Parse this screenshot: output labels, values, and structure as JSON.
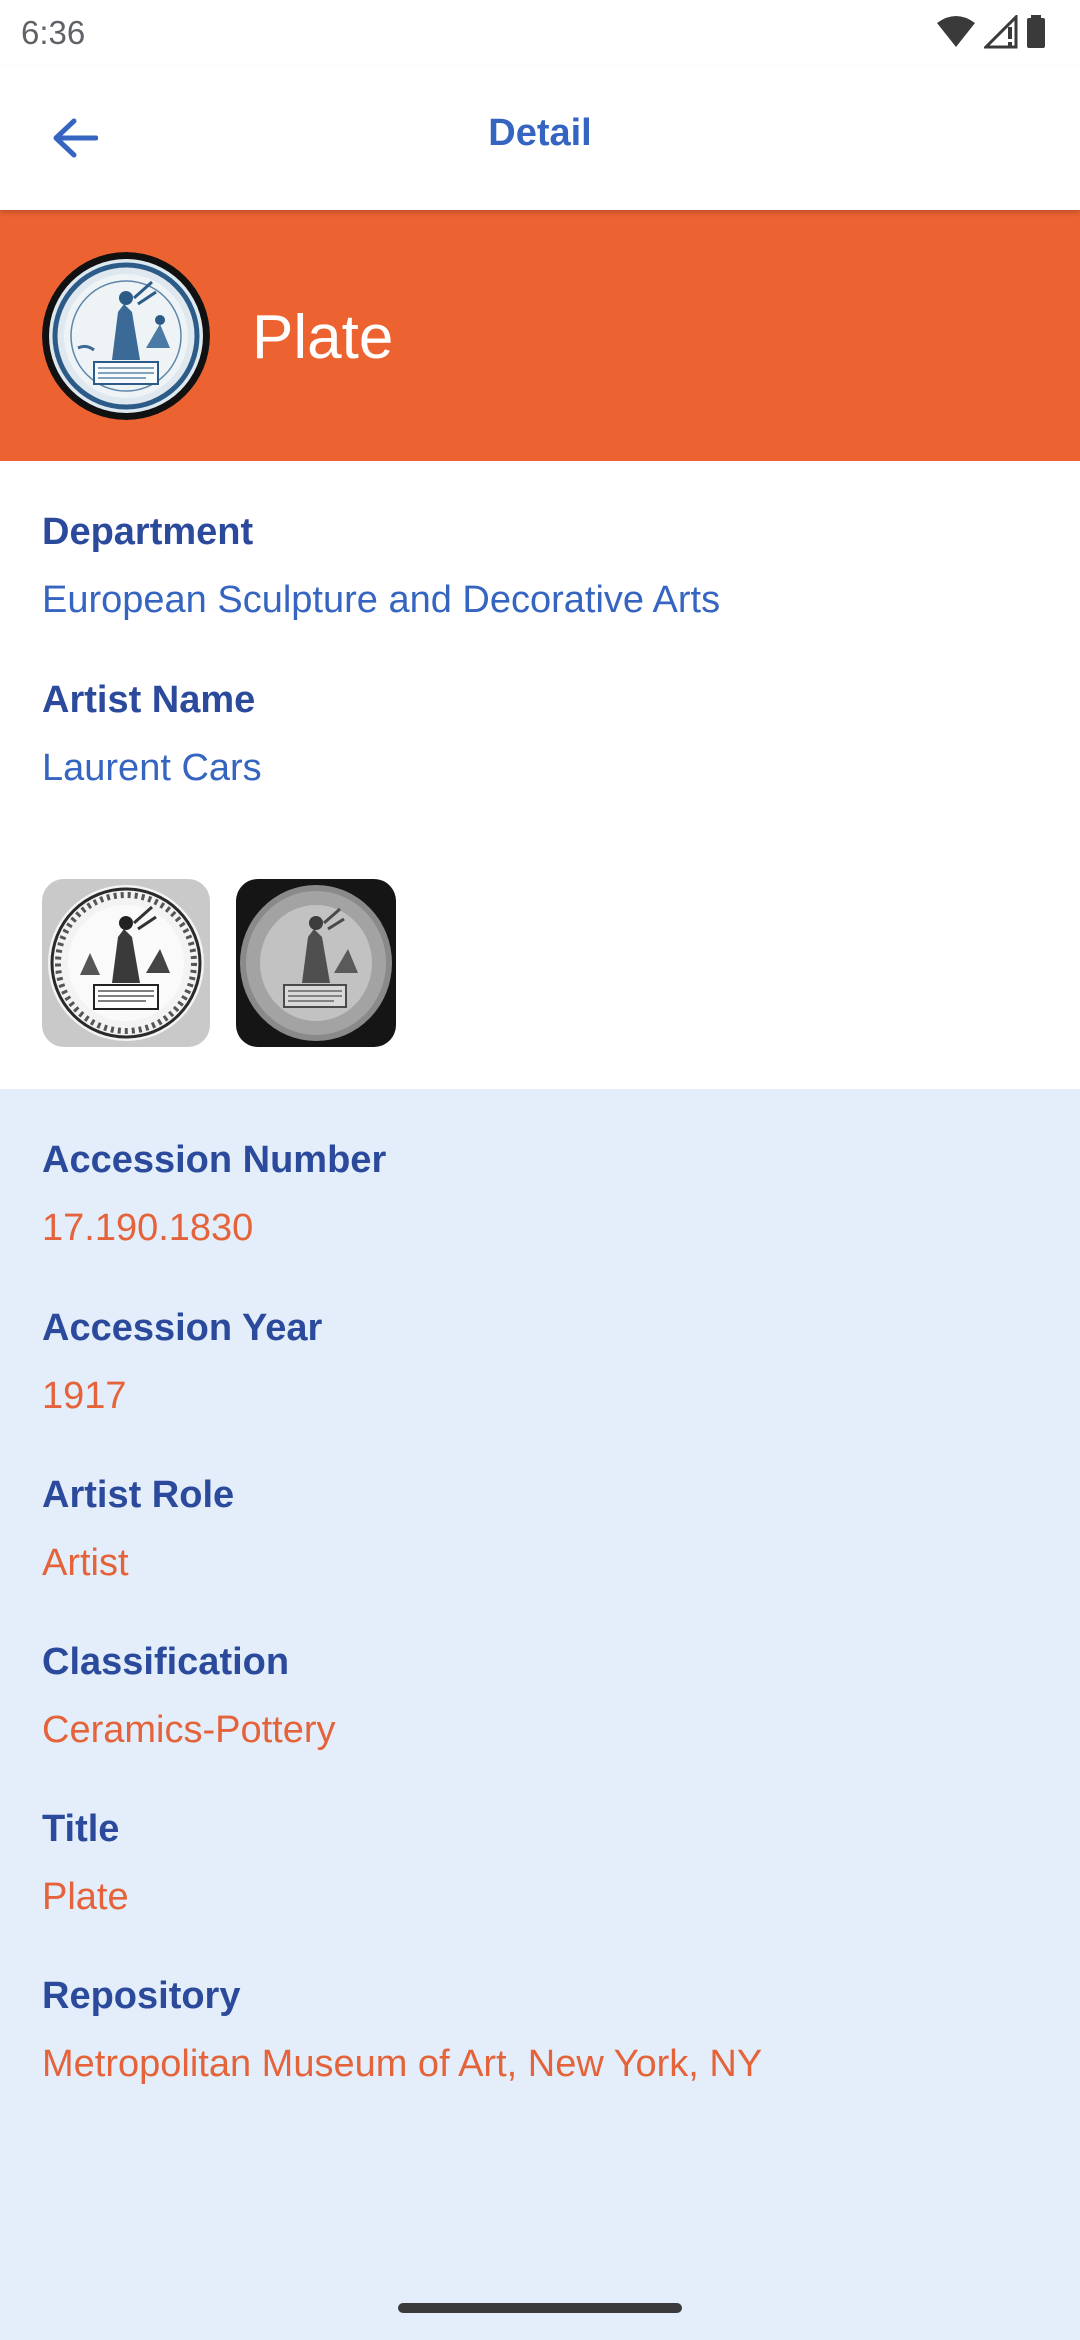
{
  "status_bar": {
    "time": "6:36",
    "icons": [
      "wifi-icon",
      "signal-icon",
      "battery-icon"
    ]
  },
  "app_bar": {
    "back_icon": "arrow-left-icon",
    "title": "Detail"
  },
  "header": {
    "title": "Plate",
    "thumbnail": "plate-thumbnail-image"
  },
  "primary": {
    "department_label": "Department",
    "department_value": "European Sculpture and Decorative Arts",
    "artist_name_label": "Artist Name",
    "artist_name_value": "Laurent Cars",
    "gallery": [
      "plate-photo-1",
      "plate-photo-2"
    ]
  },
  "details": {
    "accession_number_label": "Accession Number",
    "accession_number_value": "17.190.1830",
    "accession_year_label": "Accession Year",
    "accession_year_value": "1917",
    "artist_role_label": "Artist Role",
    "artist_role_value": "Artist",
    "classification_label": "Classification",
    "classification_value": "Ceramics-Pottery",
    "title_label": "Title",
    "title_value": "Plate",
    "repository_label": "Repository",
    "repository_value": "Metropolitan Museum of Art, New York, NY"
  },
  "colors": {
    "accent_orange": "#ec6331",
    "label_blue": "#2b4a9c",
    "value_blue": "#3565c0",
    "value_orange": "#e5633a",
    "details_background": "#e3eefa"
  }
}
